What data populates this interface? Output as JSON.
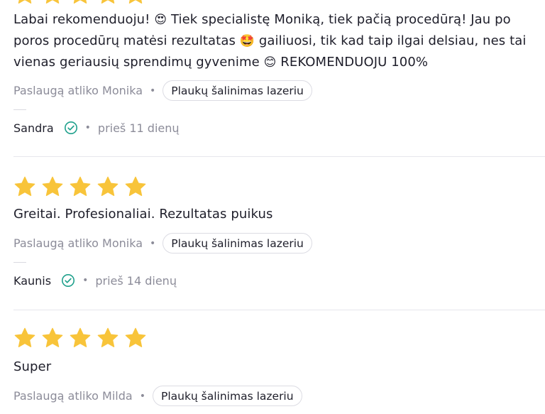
{
  "colors": {
    "star": "#f8c43a",
    "verified": "#1fa08c",
    "divider": "#e6e6ec",
    "muted_text": "#8c8c99",
    "text": "#1e1e2a"
  },
  "reviews": [
    {
      "rating": 5,
      "text_parts": [
        "Labai rekomenduoju! ",
        "😍",
        " Tiek specialistę Moniką, tiek pačią procedūrą! Jau po poros procedūrų matėsi rezultatas ",
        "🤩",
        " gailiuosi, tik kad taip ilgai delsiau, nes tai vienas geriausių sprendimų gyvenime ",
        "😊",
        " REKOMENDUOJU 100%"
      ],
      "performed_by": "Paslaugą atliko Monika",
      "service": "Plaukų šalinimas lazeriu",
      "author": "Sandra",
      "date": "prieš 11 dienų"
    },
    {
      "rating": 5,
      "text": "Greitai. Profesionaliai. Rezultatas puikus",
      "performed_by": "Paslaugą atliko Monika",
      "service": "Plaukų šalinimas lazeriu",
      "author": "Kaunis",
      "date": "prieš 14 dienų"
    },
    {
      "rating": 5,
      "text": "Super",
      "performed_by": "Paslaugą atliko Milda",
      "service": "Plaukų šalinimas lazeriu"
    }
  ],
  "separator": "•",
  "icons": {
    "star": "star-icon",
    "verified": "verified-check-icon"
  }
}
